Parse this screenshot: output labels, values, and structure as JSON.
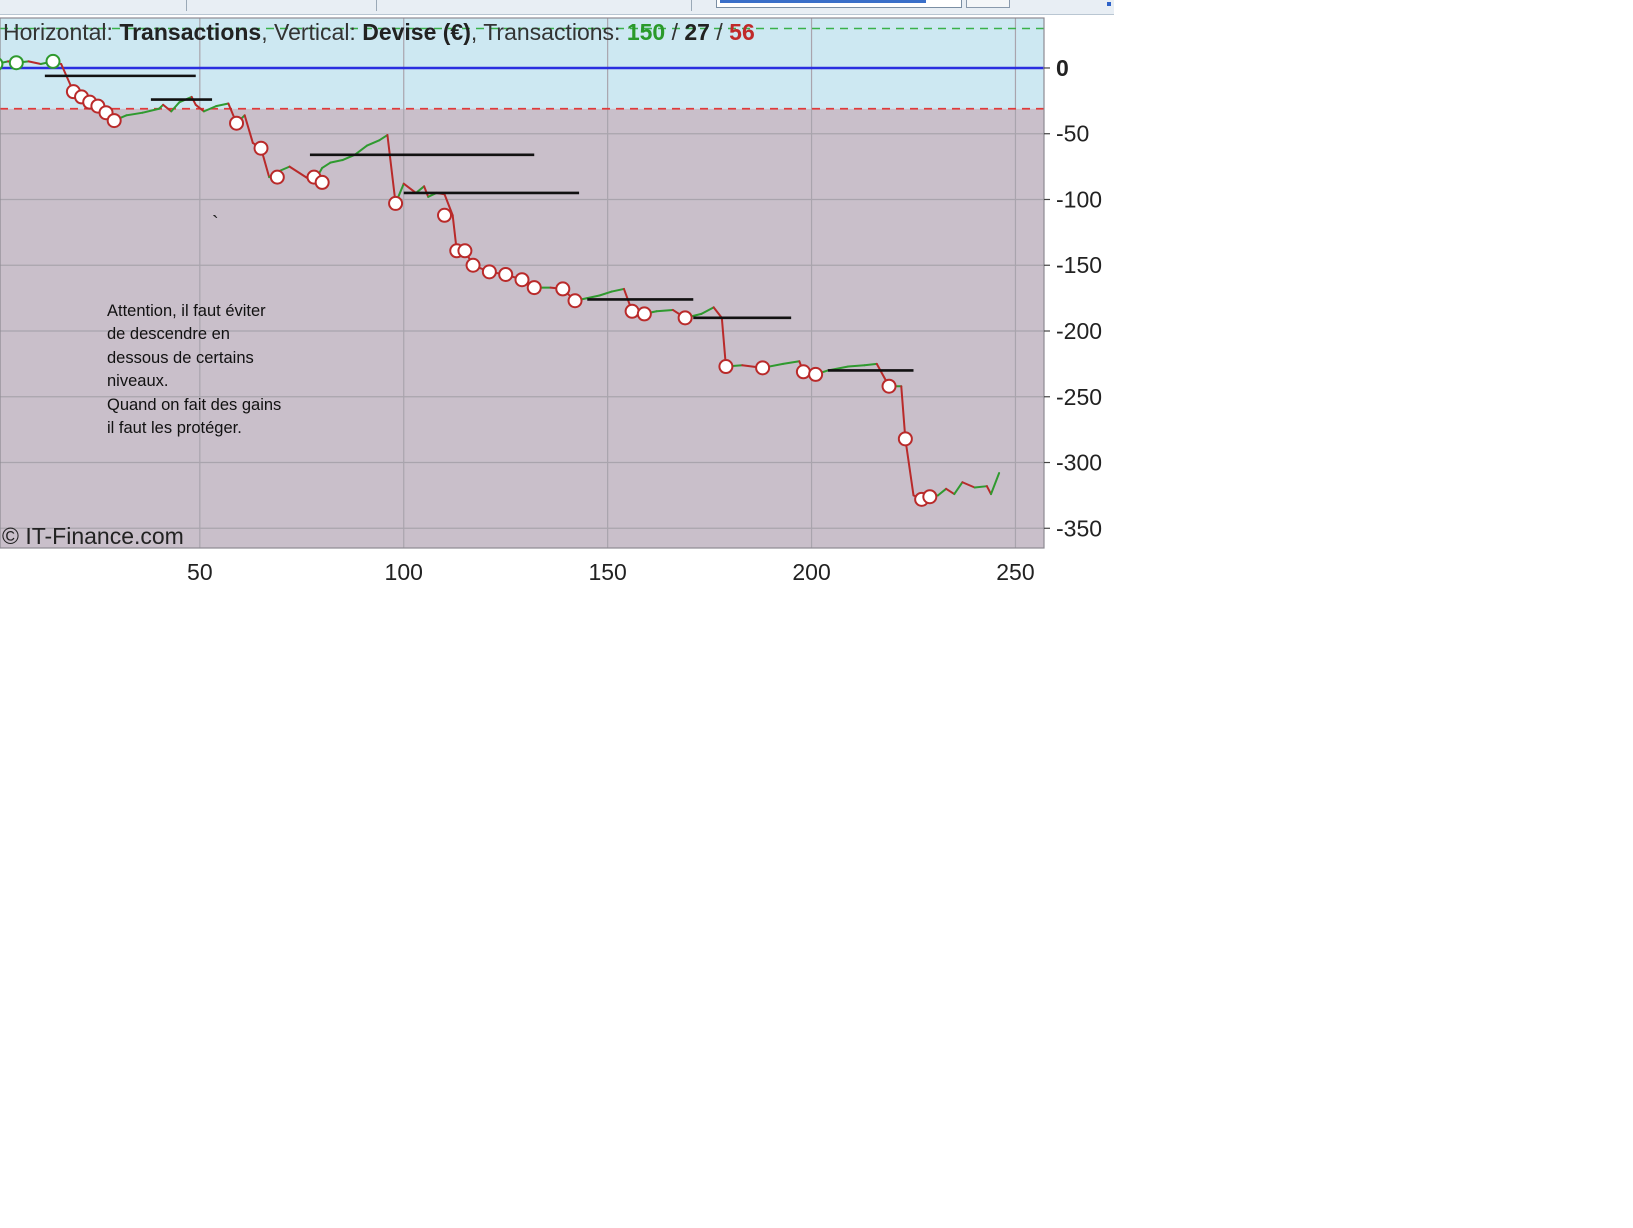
{
  "chart_data": {
    "type": "line",
    "header": {
      "horizontal_prefix": "Horizontal: ",
      "horizontal_value": "Transactions",
      "vertical_prefix": ", Vertical: ",
      "vertical_value": "Devise (€)",
      "transactions_prefix": ", Transactions: ",
      "total": "150",
      "sep1": " / ",
      "wins": "27",
      "sep2": " / ",
      "losses": "56"
    },
    "xlim": [
      1,
      257
    ],
    "ylim": [
      -365,
      38
    ],
    "x_ticks": [
      50,
      100,
      150,
      200,
      250
    ],
    "x_tick_labels": [
      "50",
      "100",
      "150",
      "200",
      "250"
    ],
    "y_ticks": [
      0,
      -50,
      -100,
      -150,
      -200,
      -250,
      -300,
      -350
    ],
    "y_tick_labels": [
      "0",
      "-50",
      "-100",
      "-150",
      "-200",
      "-250",
      "-300",
      "-350"
    ],
    "grid": true,
    "zero_line": 0,
    "upper_band_line": 30,
    "lower_band_line": -31,
    "equity": [
      [
        0,
        3
      ],
      [
        3,
        5
      ],
      [
        5,
        4
      ],
      [
        8,
        5
      ],
      [
        11,
        3
      ],
      [
        14,
        5
      ],
      [
        16,
        3
      ],
      [
        19,
        -18
      ],
      [
        21,
        -22
      ],
      [
        23,
        -26
      ],
      [
        25,
        -29
      ],
      [
        27,
        -34
      ],
      [
        29,
        -40
      ],
      [
        32,
        -36
      ],
      [
        36,
        -34
      ],
      [
        40,
        -31
      ],
      [
        41,
        -28
      ],
      [
        43,
        -33
      ],
      [
        45,
        -26
      ],
      [
        48,
        -22
      ],
      [
        49,
        -28
      ],
      [
        51,
        -33
      ],
      [
        54,
        -29
      ],
      [
        57,
        -27
      ],
      [
        59,
        -42
      ],
      [
        61,
        -36
      ],
      [
        63,
        -57
      ],
      [
        65,
        -61
      ],
      [
        67,
        -83
      ],
      [
        69,
        -79
      ],
      [
        72,
        -75
      ],
      [
        76,
        -83
      ],
      [
        78,
        -87
      ],
      [
        80,
        -76
      ],
      [
        82,
        -72
      ],
      [
        85,
        -70
      ],
      [
        88,
        -66
      ],
      [
        91,
        -59
      ],
      [
        94,
        -55
      ],
      [
        96,
        -51
      ],
      [
        98,
        -103
      ],
      [
        100,
        -88
      ],
      [
        103,
        -95
      ],
      [
        105,
        -90
      ],
      [
        106,
        -98
      ],
      [
        108,
        -95
      ],
      [
        110,
        -96
      ],
      [
        112,
        -112
      ],
      [
        113,
        -139
      ],
      [
        115,
        -139
      ],
      [
        117,
        -150
      ],
      [
        121,
        -155
      ],
      [
        125,
        -157
      ],
      [
        129,
        -161
      ],
      [
        132,
        -167
      ],
      [
        136,
        -167
      ],
      [
        139,
        -168
      ],
      [
        142,
        -177
      ],
      [
        145,
        -175
      ],
      [
        148,
        -173
      ],
      [
        151,
        -170
      ],
      [
        154,
        -168
      ],
      [
        156,
        -185
      ],
      [
        159,
        -187
      ],
      [
        162,
        -185
      ],
      [
        166,
        -184
      ],
      [
        169,
        -190
      ],
      [
        173,
        -187
      ],
      [
        176,
        -182
      ],
      [
        178,
        -190
      ],
      [
        179,
        -227
      ],
      [
        183,
        -226
      ],
      [
        188,
        -228
      ],
      [
        193,
        -225
      ],
      [
        197,
        -223
      ],
      [
        198,
        -231
      ],
      [
        201,
        -233
      ],
      [
        204,
        -230
      ],
      [
        209,
        -227
      ],
      [
        213,
        -226
      ],
      [
        216,
        -225
      ],
      [
        219,
        -242
      ],
      [
        222,
        -242
      ],
      [
        223,
        -282
      ],
      [
        225,
        -325
      ],
      [
        227,
        -328
      ],
      [
        229,
        -326
      ],
      [
        231,
        -325
      ],
      [
        233,
        -320
      ],
      [
        235,
        -324
      ],
      [
        237,
        -315
      ],
      [
        240,
        -319
      ],
      [
        243,
        -318
      ],
      [
        244,
        -324
      ],
      [
        246,
        -308
      ]
    ],
    "trade_markers": [
      {
        "x": 0,
        "y": 3,
        "type": "win"
      },
      {
        "x": 5,
        "y": 4,
        "type": "win"
      },
      {
        "x": 14,
        "y": 5,
        "type": "win"
      },
      {
        "x": 19,
        "y": -18,
        "type": "loss"
      },
      {
        "x": 21,
        "y": -22,
        "type": "loss"
      },
      {
        "x": 23,
        "y": -26,
        "type": "loss"
      },
      {
        "x": 25,
        "y": -29,
        "type": "loss"
      },
      {
        "x": 27,
        "y": -34,
        "type": "loss"
      },
      {
        "x": 29,
        "y": -40,
        "type": "loss"
      },
      {
        "x": 59,
        "y": -42,
        "type": "loss"
      },
      {
        "x": 65,
        "y": -61,
        "type": "loss"
      },
      {
        "x": 69,
        "y": -83,
        "type": "loss"
      },
      {
        "x": 78,
        "y": -83,
        "type": "loss"
      },
      {
        "x": 80,
        "y": -87,
        "type": "loss"
      },
      {
        "x": 98,
        "y": -103,
        "type": "loss"
      },
      {
        "x": 110,
        "y": -112,
        "type": "loss"
      },
      {
        "x": 113,
        "y": -139,
        "type": "loss"
      },
      {
        "x": 115,
        "y": -139,
        "type": "loss"
      },
      {
        "x": 117,
        "y": -150,
        "type": "loss"
      },
      {
        "x": 121,
        "y": -155,
        "type": "loss"
      },
      {
        "x": 125,
        "y": -157,
        "type": "loss"
      },
      {
        "x": 129,
        "y": -161,
        "type": "loss"
      },
      {
        "x": 132,
        "y": -167,
        "type": "loss"
      },
      {
        "x": 139,
        "y": -168,
        "type": "loss"
      },
      {
        "x": 142,
        "y": -177,
        "type": "loss"
      },
      {
        "x": 156,
        "y": -185,
        "type": "loss"
      },
      {
        "x": 159,
        "y": -187,
        "type": "loss"
      },
      {
        "x": 169,
        "y": -190,
        "type": "loss"
      },
      {
        "x": 179,
        "y": -227,
        "type": "loss"
      },
      {
        "x": 188,
        "y": -228,
        "type": "loss"
      },
      {
        "x": 198,
        "y": -231,
        "type": "loss"
      },
      {
        "x": 201,
        "y": -233,
        "type": "loss"
      },
      {
        "x": 219,
        "y": -242,
        "type": "loss"
      },
      {
        "x": 223,
        "y": -282,
        "type": "loss"
      },
      {
        "x": 227,
        "y": -328,
        "type": "loss"
      },
      {
        "x": 229,
        "y": -326,
        "type": "loss"
      }
    ],
    "support_levels": [
      {
        "x1": 12,
        "x2": 49,
        "y": -6
      },
      {
        "x1": 38,
        "x2": 53,
        "y": -24
      },
      {
        "x1": 77,
        "x2": 132,
        "y": -66
      },
      {
        "x1": 100,
        "x2": 143,
        "y": -95
      },
      {
        "x1": 145,
        "x2": 171,
        "y": -176
      },
      {
        "x1": 171,
        "x2": 195,
        "y": -190
      },
      {
        "x1": 204,
        "x2": 225,
        "y": -230
      }
    ],
    "annotation_lines": [
      "Attention, il faut éviter",
      "de descendre en",
      "dessous de certains",
      "niveaux.",
      "Quand on fait des gains",
      "il faut les protéger."
    ],
    "stray_mark": "`",
    "watermark": "© IT-Finance.com"
  },
  "colors": {
    "upper_zone": "#cde8f2",
    "lower_zone": "#c9bfca",
    "zero_line": "#2a2ee0",
    "band_line_lower": "#e03a3a",
    "band_line_upper": "#3ab24a",
    "gain": "#2f9a2f",
    "loss": "#b92a2a",
    "support_line": "#111111",
    "header_total": "#2a9a2a",
    "header_wins": "#222222",
    "header_losses": "#c02a2a"
  }
}
